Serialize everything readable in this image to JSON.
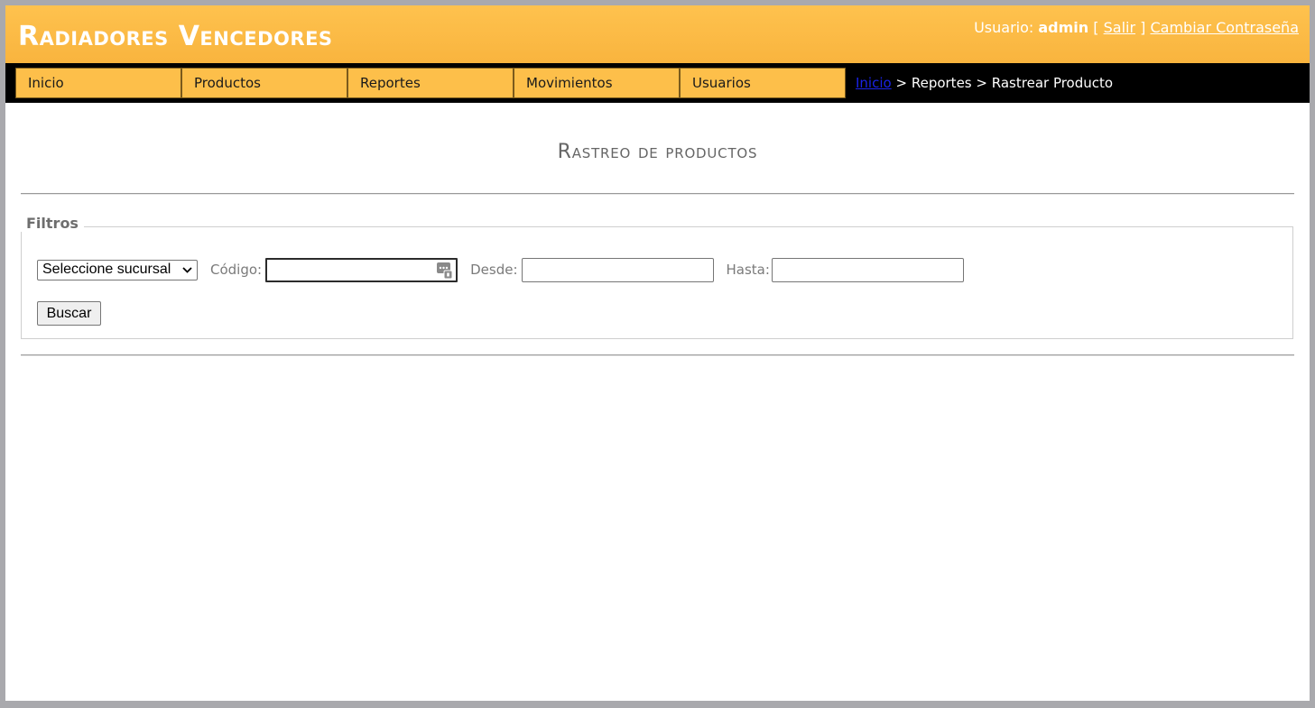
{
  "header": {
    "brand": "Radiadores Vencedores",
    "user_label": "Usuario:",
    "user_name": "admin",
    "bracket_open": "[",
    "logout": "Salir",
    "bracket_close": "]",
    "change_password": "Cambiar Contraseña"
  },
  "nav": {
    "items": [
      {
        "label": "Inicio"
      },
      {
        "label": "Productos"
      },
      {
        "label": "Reportes"
      },
      {
        "label": "Movimientos"
      },
      {
        "label": "Usuarios"
      }
    ]
  },
  "breadcrumb": {
    "home": "Inicio",
    "sep1": ">",
    "section": "Reportes",
    "sep2": ">",
    "current": "Rastrear Producto"
  },
  "page": {
    "title": "Rastreo de productos"
  },
  "filters": {
    "legend": "Filtros",
    "branch_select": "Seleccione sucursal",
    "code_label": "Código:",
    "code_value": "",
    "from_label": "Desde:",
    "from_value": "",
    "to_label": "Hasta:",
    "to_value": "",
    "search_button": "Buscar"
  },
  "colors": {
    "header_bg": "#fdbf4a",
    "nav_bg": "#000000",
    "link": "#1a23e6"
  },
  "icons": {
    "code_field": "password-manager-icon",
    "select": "chevron-down-icon"
  }
}
